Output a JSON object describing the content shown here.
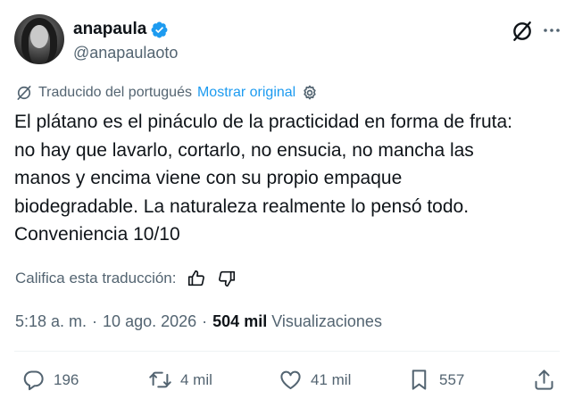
{
  "author": {
    "display_name": "anapaula",
    "handle": "@anapaulaoto",
    "verified": true,
    "verified_color": "#1d9bf0"
  },
  "header_icons": {
    "grok": "grok-icon",
    "more": "more-dots-icon"
  },
  "translation": {
    "label": "Traducido del portugués",
    "show_original": "Mostrar original",
    "settings_icon": "gear-icon"
  },
  "tweet": {
    "lines": [
      "El plátano es el pináculo de la practicidad en forma de fruta:",
      "no hay que lavarlo, cortarlo, no ensucia, no mancha las",
      "manos y encima viene con su propio empaque",
      "biodegradable. La naturaleza realmente lo pensó todo.",
      "Conveniencia 10/10"
    ]
  },
  "rating": {
    "label": "Califica esta traducción:",
    "thumbs_up_icon": "thumbs-up-icon",
    "thumbs_down_icon": "thumbs-down-icon"
  },
  "meta": {
    "time": "5:18 a. m.",
    "separator": "·",
    "date": "10 ago. 2026",
    "views_count": "504 mil",
    "views_label": "Visualizaciones"
  },
  "actions": {
    "replies": "196",
    "reposts": "4 mil",
    "likes": "41 mil",
    "bookmarks": "557"
  },
  "colors": {
    "text": "#0f1419",
    "secondary": "#536471",
    "link": "#1d9bf0"
  }
}
